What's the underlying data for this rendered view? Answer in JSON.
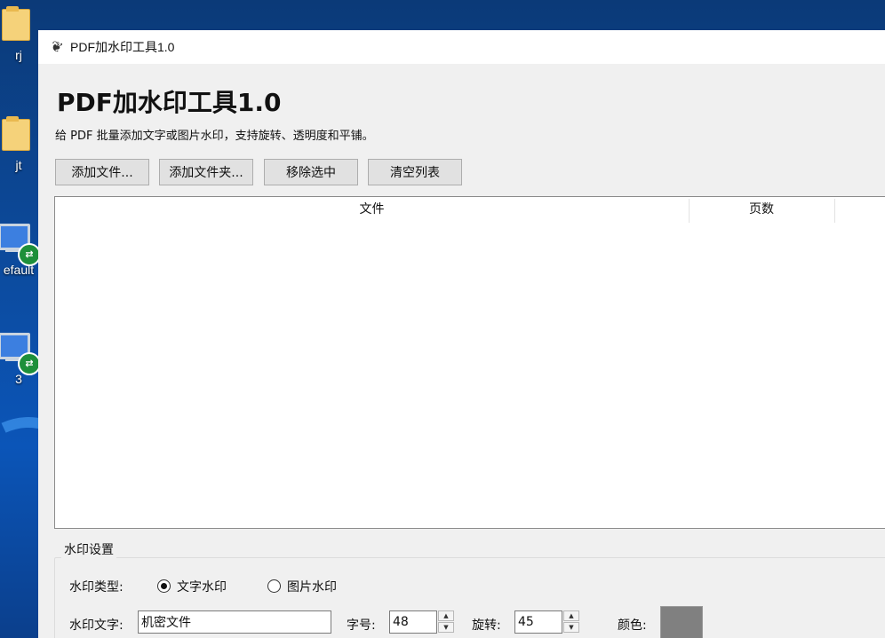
{
  "desktop": {
    "icons": [
      {
        "label": "rj",
        "icon": "folder-icon"
      },
      {
        "label": "jt",
        "icon": "folder-icon"
      },
      {
        "label": "efault",
        "icon": "remote-desktop-icon"
      },
      {
        "label": "3",
        "icon": "remote-desktop-icon"
      }
    ]
  },
  "window": {
    "title": "PDF加水印工具1.0",
    "icon": "feather-icon"
  },
  "app": {
    "title": "PDF加水印工具1.0",
    "subtitle": "给 PDF 批量添加文字或图片水印，支持旋转、透明度和平铺。"
  },
  "toolbar": {
    "add_file": "添加文件...",
    "add_folder": "添加文件夹...",
    "remove_selected": "移除选中",
    "clear_list": "清空列表"
  },
  "file_table": {
    "columns": [
      "文件",
      "页数"
    ],
    "rows": []
  },
  "watermark": {
    "group_title": "水印设置",
    "type_label": "水印类型:",
    "type_options": [
      "文字水印",
      "图片水印"
    ],
    "type_selected": "文字水印",
    "text_label": "水印文字:",
    "text_value": "机密文件",
    "font_size_label": "字号:",
    "font_size_value": "48",
    "rotation_label": "旋转:",
    "rotation_value": "45",
    "color_label": "颜色:",
    "color_value": "#808080"
  }
}
